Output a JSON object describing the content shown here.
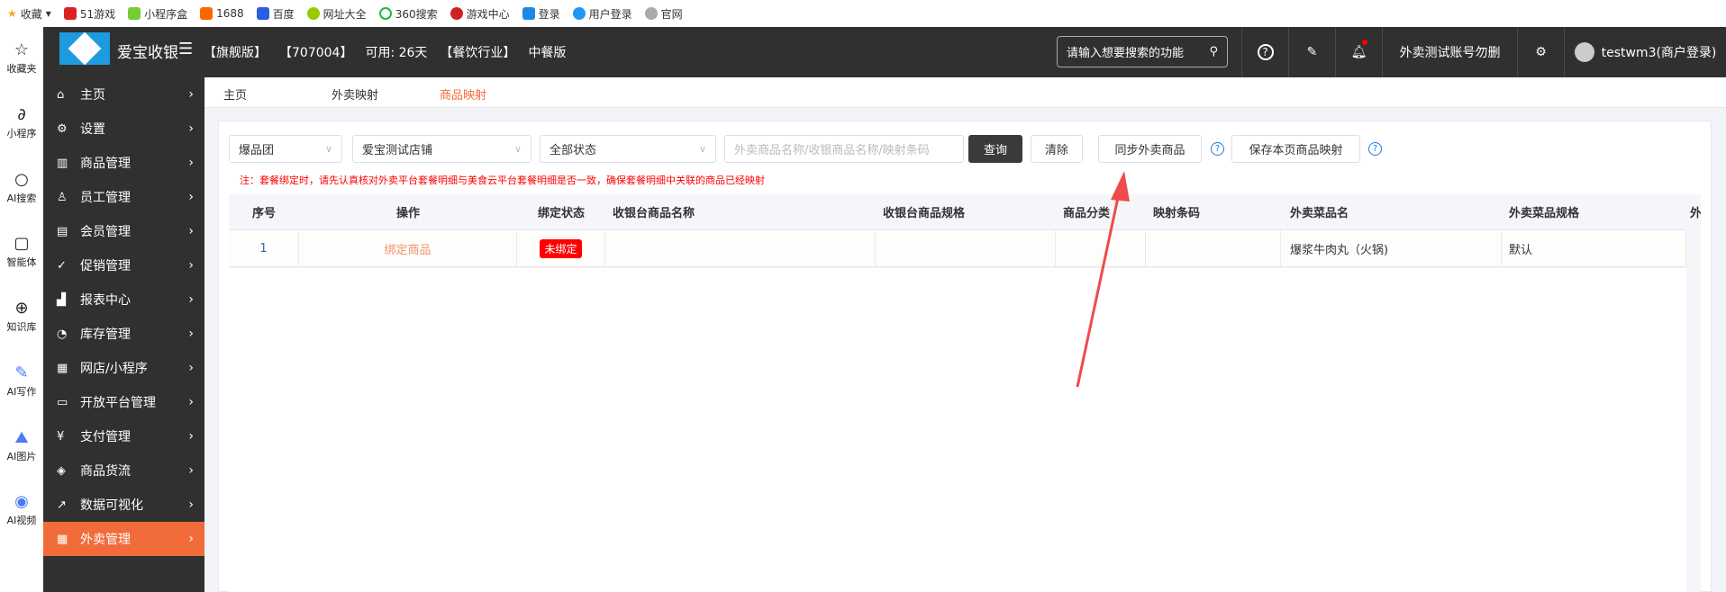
{
  "bookmarks": [
    "收藏",
    "51游戏",
    "小程序盒",
    "1688",
    "百度",
    "网址大全",
    "360搜索",
    "游戏中心",
    "登录",
    "用户登录",
    "官网"
  ],
  "left_strip": [
    {
      "label": "收藏夹",
      "icon": "star-icon"
    },
    {
      "label": "小程序",
      "icon": "link-icon"
    },
    {
      "label": "AI搜索",
      "icon": "search-icon"
    },
    {
      "label": "智能体",
      "icon": "agent-icon"
    },
    {
      "label": "知识库",
      "icon": "bulb-icon"
    },
    {
      "label": "AI写作",
      "icon": "write-icon"
    },
    {
      "label": "AI图片",
      "icon": "image-icon"
    },
    {
      "label": "AI视频",
      "icon": "video-icon"
    }
  ],
  "header": {
    "title": "爱宝收银",
    "edition": "【旗舰版】",
    "code": "【707004】",
    "available": "可用: 26天",
    "industry": "【餐饮行业】",
    "type": "中餐版",
    "search_placeholder": "请输入想要搜索的功能",
    "account": "外卖测试账号勿删",
    "user": "testwm3(商户登录)"
  },
  "sidebar": [
    {
      "label": "主页",
      "icon": "home-icon"
    },
    {
      "label": "设置",
      "icon": "gear-icon"
    },
    {
      "label": "商品管理",
      "icon": "barcode-icon"
    },
    {
      "label": "员工管理",
      "icon": "staff-icon"
    },
    {
      "label": "会员管理",
      "icon": "member-icon"
    },
    {
      "label": "促销管理",
      "icon": "check-circle-icon"
    },
    {
      "label": "报表中心",
      "icon": "report-icon"
    },
    {
      "label": "库存管理",
      "icon": "pie-icon"
    },
    {
      "label": "网店/小程序",
      "icon": "shop-icon"
    },
    {
      "label": "开放平台管理",
      "icon": "monitor-icon"
    },
    {
      "label": "支付管理",
      "icon": "yuan-icon"
    },
    {
      "label": "商品货流",
      "icon": "cube-icon"
    },
    {
      "label": "数据可视化",
      "icon": "chart-icon"
    },
    {
      "label": "外卖管理",
      "icon": "shop-icon",
      "active": true
    }
  ],
  "tabs": [
    "主页",
    "外卖映射",
    "商品映射"
  ],
  "active_tab": "商品映射",
  "filters": {
    "platform": "爆品团",
    "store": "爱宝测试店铺",
    "status": "全部状态",
    "search_placeholder": "外卖商品名称/收银商品名称/映射条码",
    "query": "查询",
    "clear": "清除",
    "sync": "同步外卖商品",
    "save": "保存本页商品映射"
  },
  "note": "注：套餐绑定时，请先认真核对外卖平台套餐明细与美食云平台套餐明细是否一致，确保套餐明细中关联的商品已经映射",
  "table": {
    "columns": [
      "序号",
      "操作",
      "绑定状态",
      "收银台商品名称",
      "收银台商品规格",
      "商品分类",
      "映射条码",
      "外卖菜品名",
      "外卖菜品规格",
      "外"
    ],
    "rows": [
      {
        "no": "1",
        "action": "绑定商品",
        "status": "未绑定",
        "pos_name": "",
        "pos_spec": "",
        "category": "",
        "barcode": "",
        "wm_name": "爆浆牛肉丸（火锅)",
        "wm_spec": "默认"
      }
    ]
  },
  "colors": {
    "accent": "#f26c3b",
    "header_bg": "#303030",
    "unbound": "#ff0000",
    "annotation_arrow": "#f04b4b"
  }
}
